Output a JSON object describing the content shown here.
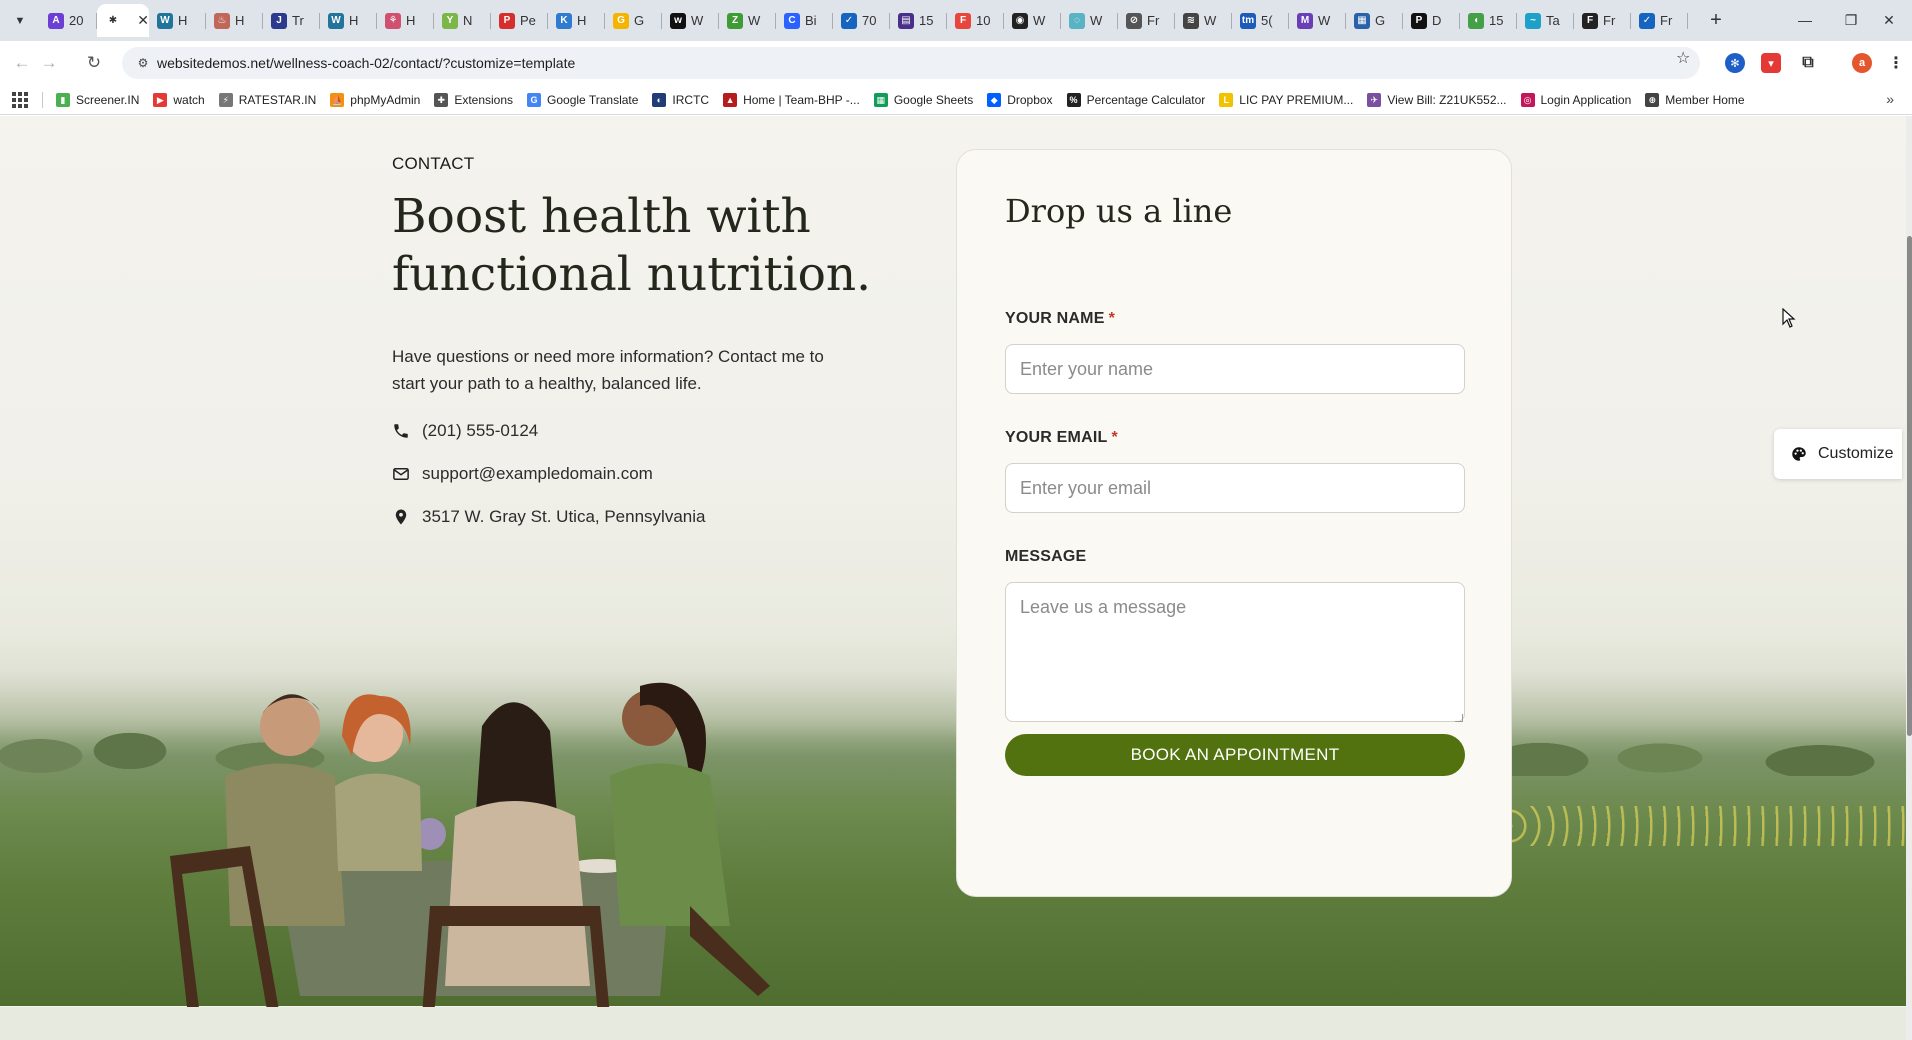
{
  "browser": {
    "tabs": [
      {
        "label": "20",
        "favicon_color": "#6b3fd4",
        "glyph": "A"
      },
      {
        "label": "",
        "favicon_color": "#333333",
        "glyph": "✱",
        "active": true
      },
      {
        "label": "H",
        "favicon_color": "#21759b",
        "glyph": "W"
      },
      {
        "label": "H",
        "favicon_color": "#c0665a",
        "glyph": "♨"
      },
      {
        "label": "Tr",
        "favicon_color": "#2b3a8c",
        "glyph": "J"
      },
      {
        "label": "H",
        "favicon_color": "#21759b",
        "glyph": "W"
      },
      {
        "label": "H",
        "favicon_color": "#d05070",
        "glyph": "⚘"
      },
      {
        "label": "N",
        "favicon_color": "#7ab648",
        "glyph": "Y"
      },
      {
        "label": "Pe",
        "favicon_color": "#d62d2d",
        "glyph": "P"
      },
      {
        "label": "H",
        "favicon_color": "#2e7bcf",
        "glyph": "K"
      },
      {
        "label": "G",
        "favicon_color": "#f4b400",
        "glyph": "G"
      },
      {
        "label": "W",
        "favicon_color": "#111111",
        "glyph": "w"
      },
      {
        "label": "W",
        "favicon_color": "#3f9c35",
        "glyph": "Z"
      },
      {
        "label": "Bi",
        "favicon_color": "#2962ff",
        "glyph": "C"
      },
      {
        "label": "70",
        "favicon_color": "#1565c0",
        "glyph": "✓"
      },
      {
        "label": "15",
        "favicon_color": "#4a2f8a",
        "glyph": "▤"
      },
      {
        "label": "10",
        "favicon_color": "#e8453c",
        "glyph": "F"
      },
      {
        "label": "W",
        "favicon_color": "#222222",
        "glyph": "◉"
      },
      {
        "label": "W",
        "favicon_color": "#58b3c4",
        "glyph": "◌"
      },
      {
        "label": "Fr",
        "favicon_color": "#555555",
        "glyph": "⊘"
      },
      {
        "label": "W",
        "favicon_color": "#444444",
        "glyph": "≋"
      },
      {
        "label": "5(",
        "favicon_color": "#1e5bb8",
        "glyph": "tm"
      },
      {
        "label": "W",
        "favicon_color": "#6a3fb5",
        "glyph": "M"
      },
      {
        "label": "G",
        "favicon_color": "#2962a8",
        "glyph": "▦"
      },
      {
        "label": "D",
        "favicon_color": "#111111",
        "glyph": "P"
      },
      {
        "label": "15",
        "favicon_color": "#43a047",
        "glyph": "◖"
      },
      {
        "label": "Ta",
        "favicon_color": "#1da1c8",
        "glyph": "~"
      },
      {
        "label": "Fr",
        "favicon_color": "#222222",
        "glyph": "F"
      },
      {
        "label": "Fr",
        "favicon_color": "#1565c0",
        "glyph": "✓"
      }
    ],
    "url": "websitedemos.net/wellness-coach-02/contact/?customize=template",
    "bookmarks": [
      {
        "label": "Screener.IN",
        "color": "#4caf50",
        "glyph": "▮"
      },
      {
        "label": "watch",
        "color": "#e53935",
        "glyph": "▶"
      },
      {
        "label": "RATESTAR.IN",
        "color": "#777777",
        "glyph": "⚡"
      },
      {
        "label": "phpMyAdmin",
        "color": "#f29111",
        "glyph": "⛵"
      },
      {
        "label": "Extensions",
        "color": "#555555",
        "glyph": "✚"
      },
      {
        "label": "Google Translate",
        "color": "#4285f4",
        "glyph": "G"
      },
      {
        "label": "IRCTC",
        "color": "#213d77",
        "glyph": "◐"
      },
      {
        "label": "Home | Team-BHP -...",
        "color": "#b71c1c",
        "glyph": "▲"
      },
      {
        "label": "Google Sheets",
        "color": "#0f9d58",
        "glyph": "▦"
      },
      {
        "label": "Dropbox",
        "color": "#0061fe",
        "glyph": "◆"
      },
      {
        "label": "Percentage Calculator",
        "color": "#222222",
        "glyph": "%"
      },
      {
        "label": "LIC PAY PREMIUM...",
        "color": "#f2c200",
        "glyph": "L"
      },
      {
        "label": "View Bill: Z21UK552...",
        "color": "#7b4fa0",
        "glyph": "✈"
      },
      {
        "label": "Login Application",
        "color": "#c2185b",
        "glyph": "◎"
      },
      {
        "label": "Member Home",
        "color": "#444444",
        "glyph": "⊕"
      }
    ],
    "profile_initial": "a"
  },
  "page": {
    "eyebrow": "CONTACT",
    "title": "Boost health with functional nutrition.",
    "description": "Have questions or need more information? Contact me to start your path to a healthy, balanced life.",
    "phone": "(201) 555-0124",
    "email": "support@exampledomain.com",
    "address": "3517 W. Gray St. Utica, Pennsylvania"
  },
  "form": {
    "title": "Drop us a line",
    "name_label": "YOUR NAME",
    "name_placeholder": "Enter your name",
    "email_label": "YOUR EMAIL",
    "email_placeholder": "Enter your email",
    "message_label": "MESSAGE",
    "message_placeholder": "Leave us a message",
    "required_mark": "*",
    "submit_label": "BOOK AN APPOINTMENT"
  },
  "customize_label": "Customize",
  "colors": {
    "accent_green": "#52720f",
    "card_bg": "#fbf9f3",
    "heading": "#23271c"
  }
}
